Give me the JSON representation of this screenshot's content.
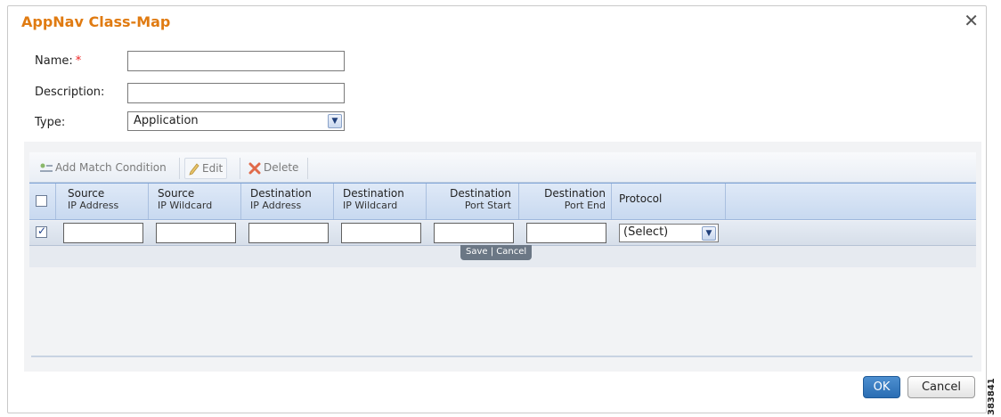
{
  "dialog": {
    "title": "AppNav Class-Map",
    "close_icon": "close-icon"
  },
  "form": {
    "name_label": "Name:",
    "required_mark": "*",
    "name_value": "",
    "description_label": "Description:",
    "description_value": "",
    "type_label": "Type:",
    "type_selected": "Application"
  },
  "toolbar": {
    "add_label": "Add Match Condition",
    "edit_label": "Edit",
    "delete_label": "Delete"
  },
  "grid": {
    "columns": [
      {
        "line1": "Source",
        "line2": "IP Address"
      },
      {
        "line1": "Source",
        "line2": "IP Wildcard"
      },
      {
        "line1": "Destination",
        "line2": "IP Address"
      },
      {
        "line1": "Destination",
        "line2": "IP Wildcard"
      },
      {
        "line1": "Destination",
        "line2": "Port Start"
      },
      {
        "line1": "Destination",
        "line2": "Port End"
      },
      {
        "line1": "Protocol",
        "line2": ""
      }
    ],
    "header_checked": false,
    "row_checked": true,
    "protocol_selected": "(Select)",
    "save_label": "Save",
    "separator": "|",
    "cancel_label": "Cancel"
  },
  "footer": {
    "ok_label": "OK",
    "cancel_label": "Cancel"
  },
  "image_id": "383841",
  "colors": {
    "title": "#e07b12",
    "ok_button": "#2a6db3",
    "required": "#e22222"
  }
}
